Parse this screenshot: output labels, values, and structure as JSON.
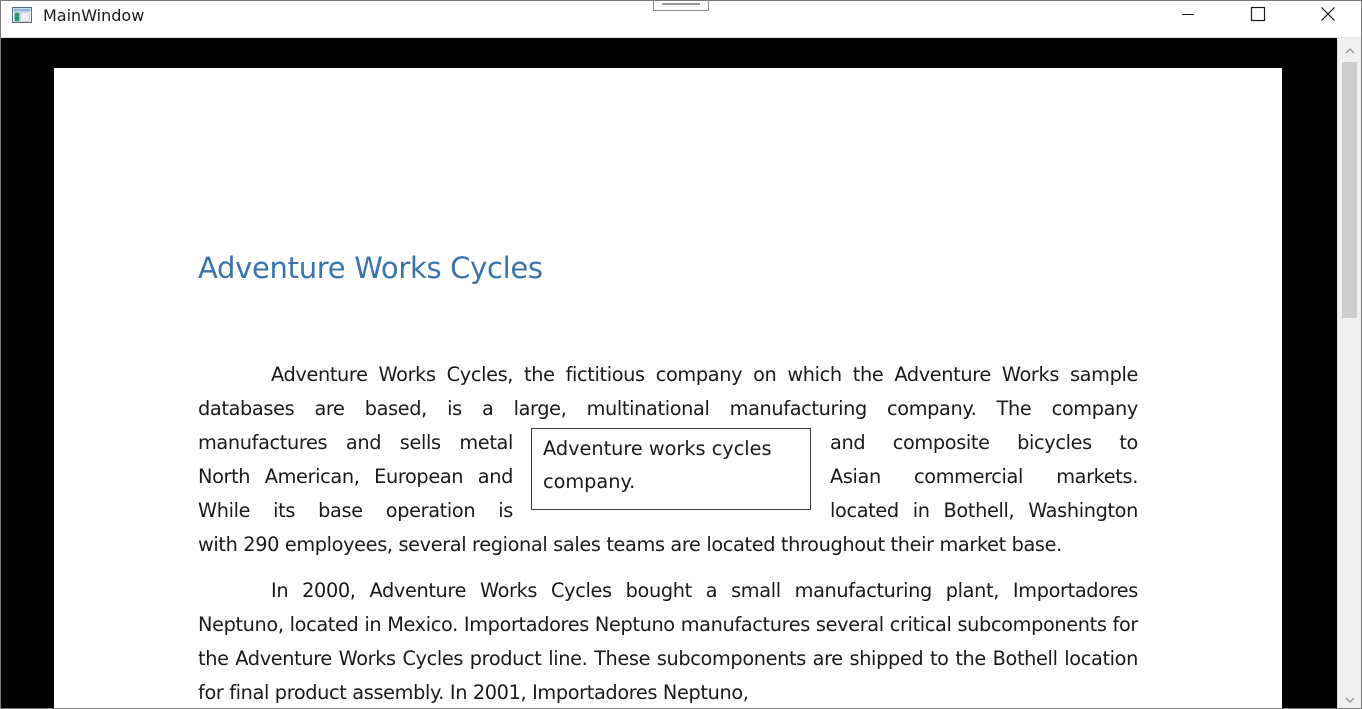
{
  "window": {
    "title": "MainWindow",
    "icons": {
      "app": "window-app-icon",
      "minimize": "minimize-icon",
      "maximize": "maximize-icon",
      "close": "close-icon"
    }
  },
  "document": {
    "heading": "Adventure Works Cycles",
    "paragraph_1": "Adventure Works Cycles, the fictitious company on which the Adventure Works sample databases are based, is a large, multinational manufacturing company. The company manufactures and sells metal and composite bicycles to North American, European and Asian commercial markets. While its base operation is located in Bothell, Washington with 290 employees, several regional sales teams are located throughout their market base.",
    "figure_text": "Adventure works cycles company.",
    "paragraph_2": "In 2000, Adventure Works Cycles bought a small manufacturing plant, Importadores Neptuno, located in Mexico. Importadores Neptuno  manufactures several critical subcomponents for the Adventure Works Cycles product line. These subcomponents are shipped to the Bothell location for final product assembly. In 2001, Importadores Neptuno,"
  },
  "scrollbar": {
    "up_icon": "scroll-up-arrow-icon",
    "down_icon": "scroll-down-arrow-icon"
  },
  "colors": {
    "heading": "#3a74ab",
    "viewer_background": "#000000",
    "page_background": "#ffffff"
  }
}
